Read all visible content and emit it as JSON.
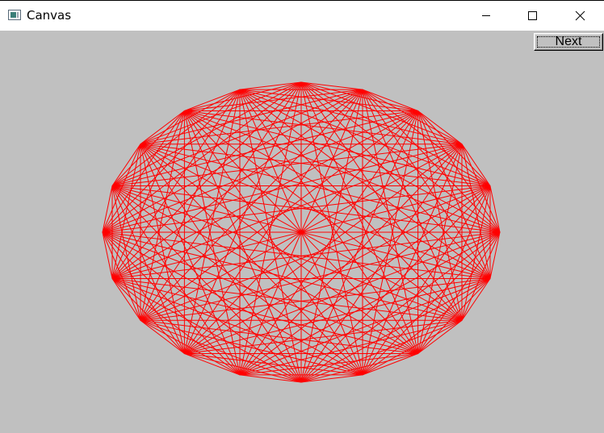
{
  "window": {
    "title": "Canvas",
    "app_icon": "window-app-icon",
    "controls": {
      "minimize_icon": "minimize-icon",
      "maximize_icon": "maximize-icon",
      "close_icon": "close-icon"
    }
  },
  "toolbar": {
    "next_label": "Next"
  },
  "canvas": {
    "background": "#c0c0c0",
    "line_color": "#ff0000",
    "figure": "complete-graph",
    "vertex_count": 20
  }
}
